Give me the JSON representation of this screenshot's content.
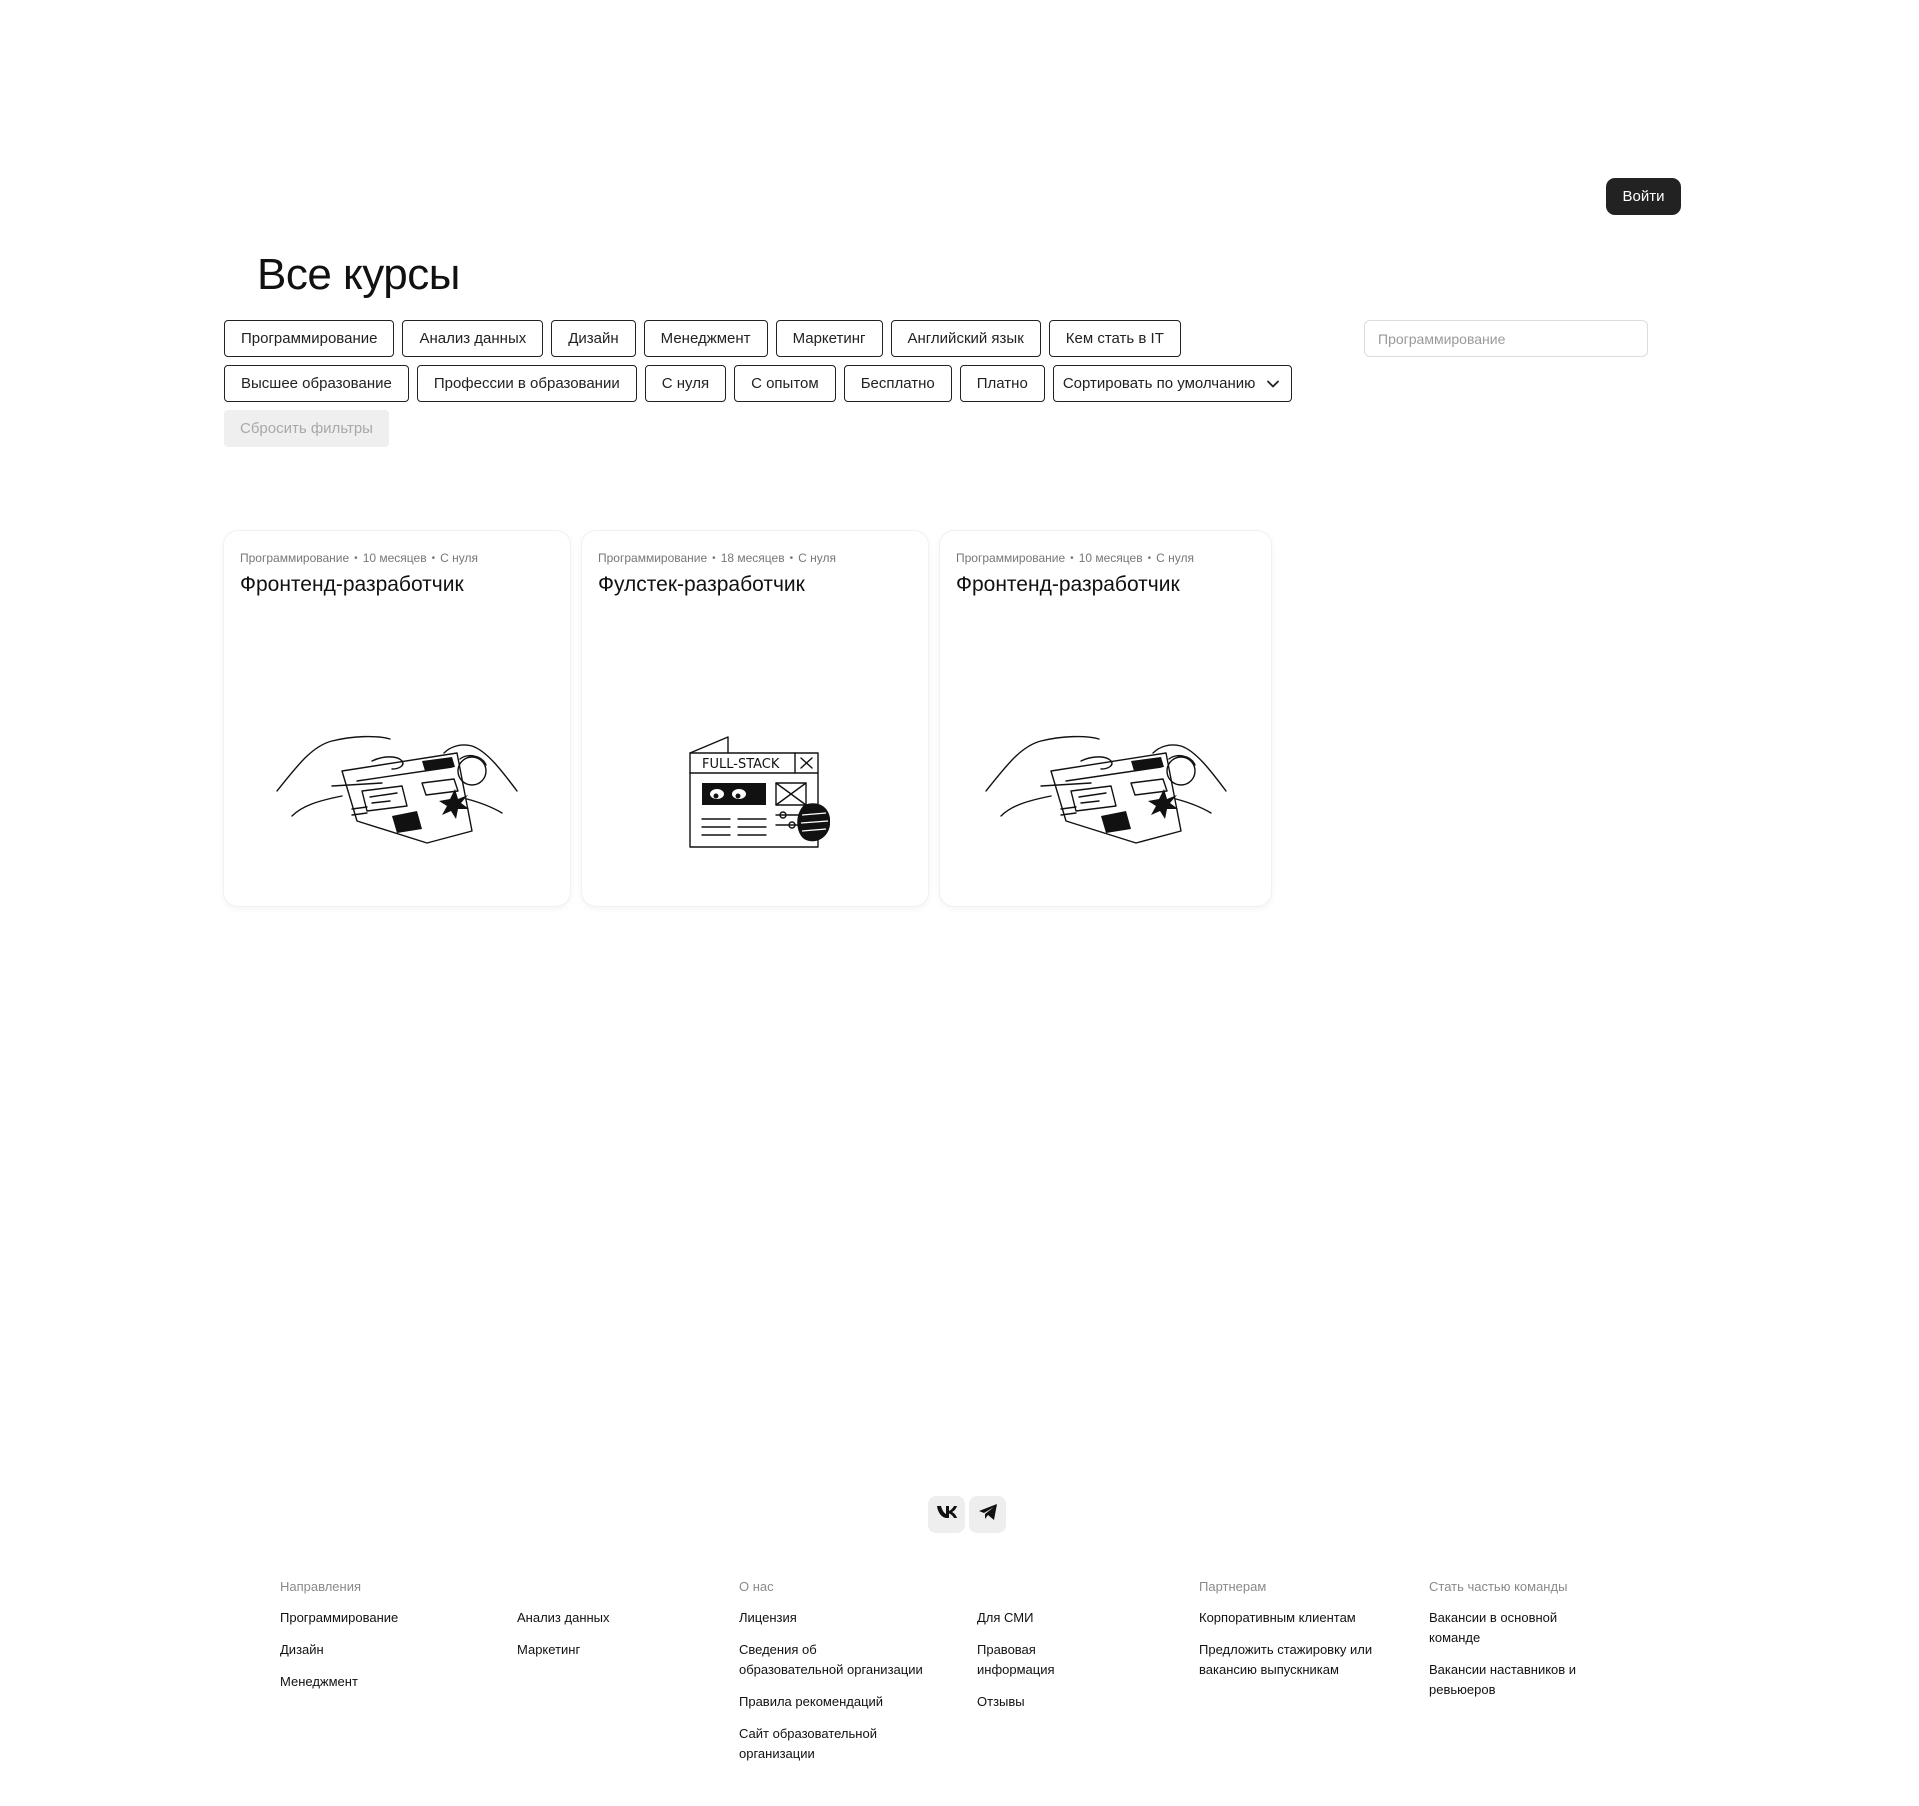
{
  "header": {
    "login_label": "Войти"
  },
  "page": {
    "title": "Все курсы"
  },
  "filters": {
    "row1": [
      "Программирование",
      "Анализ данных",
      "Дизайн",
      "Менеджмент",
      "Маркетинг",
      "Английский язык",
      "Кем стать в IT"
    ],
    "row2": [
      "Высшее образование",
      "Профессии в образовании",
      "С нуля",
      "С опытом",
      "Бесплатно",
      "Платно"
    ],
    "sort_label": "Сортировать по умолчанию",
    "reset_label": "Сбросить фильтры"
  },
  "search": {
    "placeholder": "Программирование"
  },
  "courses": [
    {
      "category": "Программирование",
      "duration": "10 месяцев",
      "level": "С нуля",
      "title": "Фронтенд-разработчик",
      "illustration": "hands-browser-illustration"
    },
    {
      "category": "Программирование",
      "duration": "18 месяцев",
      "level": "С нуля",
      "title": "Фулстек-разработчик",
      "illustration": "full-stack-window-illustration",
      "illustration_text": "FULL-STACK"
    },
    {
      "category": "Программирование",
      "duration": "10 месяцев",
      "level": "С нуля",
      "title": "Фронтенд-разработчик",
      "illustration": "hands-browser-illustration"
    }
  ],
  "socials": [
    "vk-icon",
    "telegram-icon"
  ],
  "footer": {
    "directions": {
      "heading": "Направления",
      "col1": [
        "Программирование",
        "Дизайн",
        "Менеджмент"
      ],
      "col2": [
        "Анализ данных",
        "Маркетинг"
      ]
    },
    "about": {
      "heading": "О нас",
      "col1": [
        "Лицензия",
        "Сведения об образовательной организации",
        "Правила рекомендаций",
        "Сайт образовательной организации"
      ],
      "col2": [
        "Для СМИ",
        "Правовая информация",
        "Отзывы"
      ]
    },
    "partners": {
      "heading": "Партнерам",
      "links": [
        "Корпоративным клиентам",
        "Предложить стажировку или вакансию выпускникам"
      ]
    },
    "team": {
      "heading": "Стать частью команды",
      "links": [
        "Вакансии в основной команде",
        "Вакансии наставников и ревьюеров"
      ]
    }
  }
}
